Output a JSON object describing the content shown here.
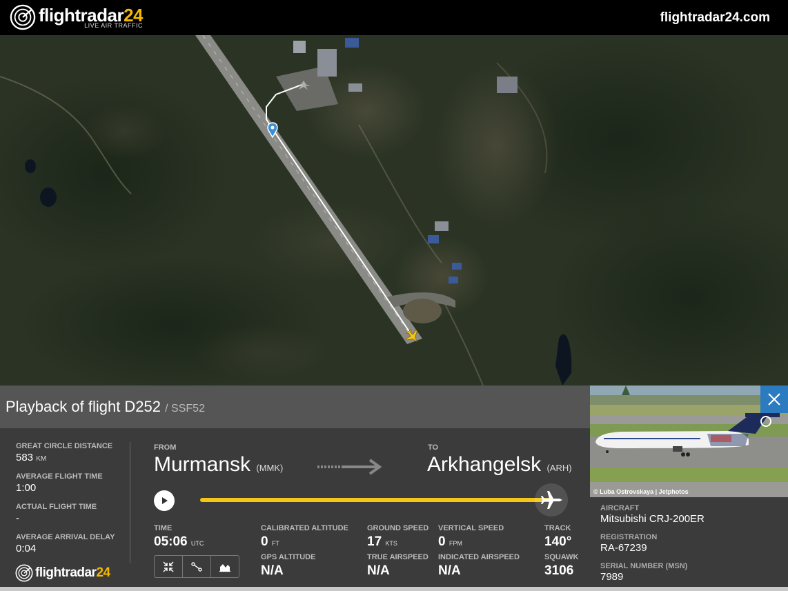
{
  "header": {
    "brand": "flightradar",
    "brand_num": "24",
    "tagline": "LIVE AIR TRAFFIC",
    "site_url": "flightradar24.com"
  },
  "panel": {
    "title": "Playback of flight D252",
    "callsign": "/ SSF52",
    "stats": [
      {
        "label": "GREAT CIRCLE DISTANCE",
        "value": "583",
        "unit": "KM"
      },
      {
        "label": "AVERAGE FLIGHT TIME",
        "value": "1:00",
        "unit": ""
      },
      {
        "label": "ACTUAL FLIGHT TIME",
        "value": "-",
        "unit": ""
      },
      {
        "label": "AVERAGE ARRIVAL DELAY",
        "value": "0:04",
        "unit": ""
      }
    ],
    "from_label": "FROM",
    "from_city": "Murmansk",
    "from_iata": "(MMK)",
    "to_label": "TO",
    "to_city": "Arkhangelsk",
    "to_iata": "(ARH)",
    "playback_progress": 1.0,
    "telemetry": {
      "time_label": "TIME",
      "time_value": "05:06",
      "time_unit": "UTC",
      "cal_alt_label": "CALIBRATED ALTITUDE",
      "cal_alt_value": "0",
      "cal_alt_unit": "FT",
      "gps_alt_label": "GPS ALTITUDE",
      "gps_alt_value": "N/A",
      "gs_label": "GROUND SPEED",
      "gs_value": "17",
      "gs_unit": "KTS",
      "tas_label": "TRUE AIRSPEED",
      "tas_value": "N/A",
      "vs_label": "VERTICAL SPEED",
      "vs_value": "0",
      "vs_unit": "FPM",
      "ias_label": "INDICATED AIRSPEED",
      "ias_value": "N/A",
      "track_label": "TRACK",
      "track_value": "140°",
      "squawk_label": "SQUAWK",
      "squawk_value": "3106"
    }
  },
  "aircraft": {
    "photo_credit": "© Luba Ostrovskaya | Jetphotos",
    "aircraft_label": "AIRCRAFT",
    "aircraft_value": "Mitsubishi CRJ-200ER",
    "reg_label": "REGISTRATION",
    "reg_value": "RA-67239",
    "msn_label": "SERIAL NUMBER (MSN)",
    "msn_value": "7989"
  },
  "colors": {
    "accent": "#f5c518",
    "close": "#2a7bbf",
    "pin": "#3a8fd6"
  }
}
